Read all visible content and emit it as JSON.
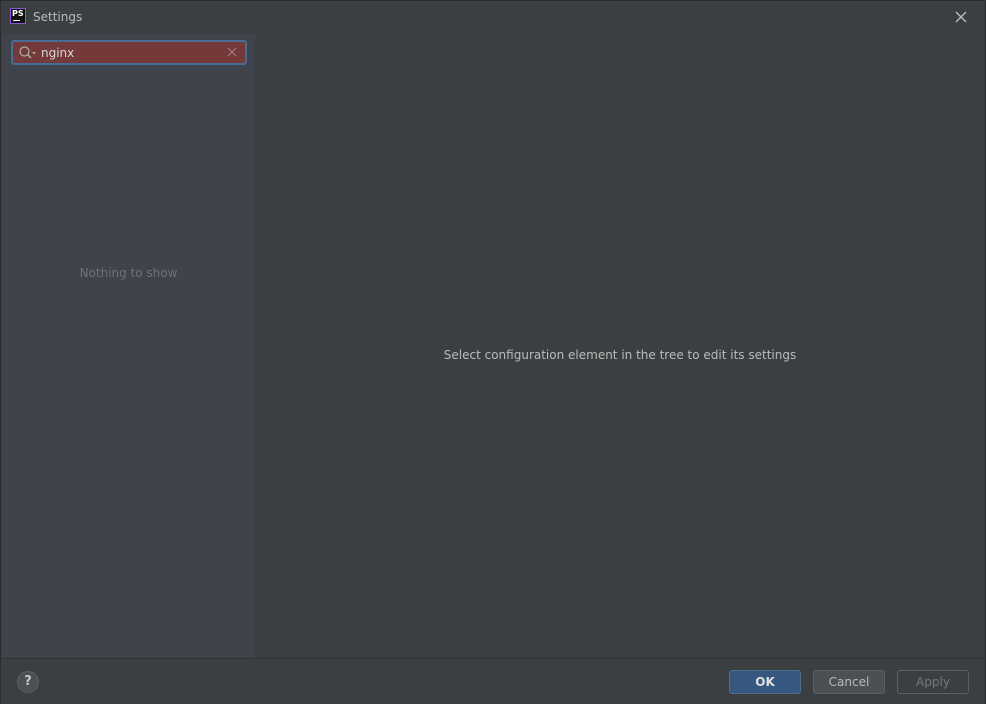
{
  "window": {
    "title": "Settings",
    "app_icon_text": "PS"
  },
  "sidebar": {
    "search": {
      "value": "nginx",
      "placeholder": ""
    },
    "empty_text": "Nothing to show"
  },
  "content": {
    "message": "Select configuration element in the tree to edit its settings"
  },
  "footer": {
    "help_label": "?",
    "ok_label": "OK",
    "cancel_label": "Cancel",
    "apply_label": "Apply"
  },
  "colors": {
    "search_error_bg": "#743a3a",
    "focus_border": "#466d94",
    "ok_button_bg": "#365880",
    "sidebar_bg": "#3e434c",
    "window_bg": "#3c3f41"
  },
  "icons": {
    "app": "phpstorm-icon",
    "close": "close-icon",
    "search": "search-icon",
    "clear": "clear-icon",
    "help": "help-icon"
  }
}
